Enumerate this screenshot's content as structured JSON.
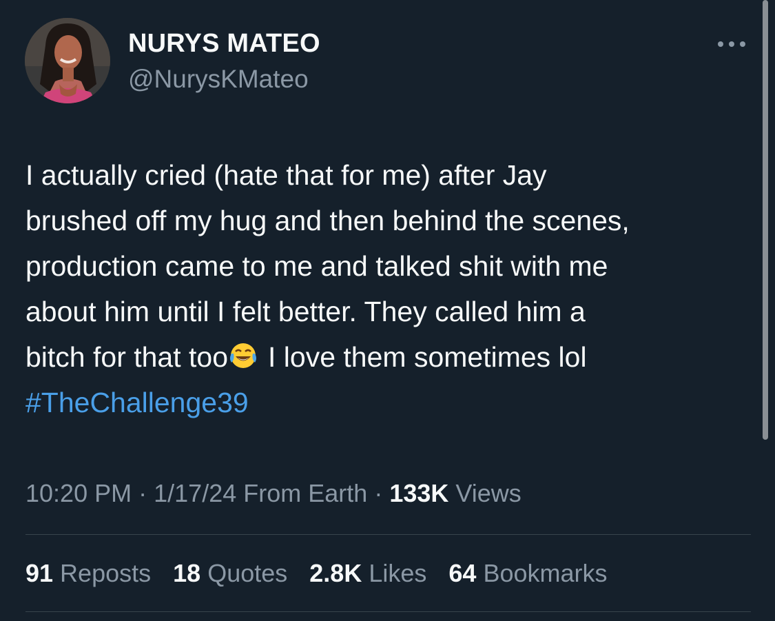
{
  "user": {
    "display_name": "NURYS MATEO",
    "handle": "@NurysKMateo",
    "avatar_icon": "profile-photo"
  },
  "menu": {
    "icon": "more-options-icon"
  },
  "tweet": {
    "lines": [
      "I actually cried (hate that for me) after Jay",
      "brushed off my hug and then behind the scenes,",
      "production came to me and talked shit with me",
      "about him until I felt better. They called him a"
    ],
    "line5_before_emoji": "bitch for that too",
    "emoji": "face-with-tears-of-joy-emoji",
    "line5_after_emoji": "I love them sometimes lol",
    "hashtag": "#TheChallenge39"
  },
  "meta": {
    "time": "10:20 PM",
    "separator": "·",
    "date": "1/17/24",
    "source": "From Earth",
    "views_count": "133K",
    "views_label": "Views"
  },
  "stats": {
    "reposts_count": "91",
    "reposts_label": "Reposts",
    "quotes_count": "18",
    "quotes_label": "Quotes",
    "likes_count": "2.8K",
    "likes_label": "Likes",
    "bookmarks_count": "64",
    "bookmarks_label": "Bookmarks"
  },
  "colors": {
    "background": "#15202b",
    "primary_text": "#f7f9f9",
    "secondary_text": "#8b98a5",
    "hashtag": "#4a9fe8",
    "divider": "#38444d"
  }
}
